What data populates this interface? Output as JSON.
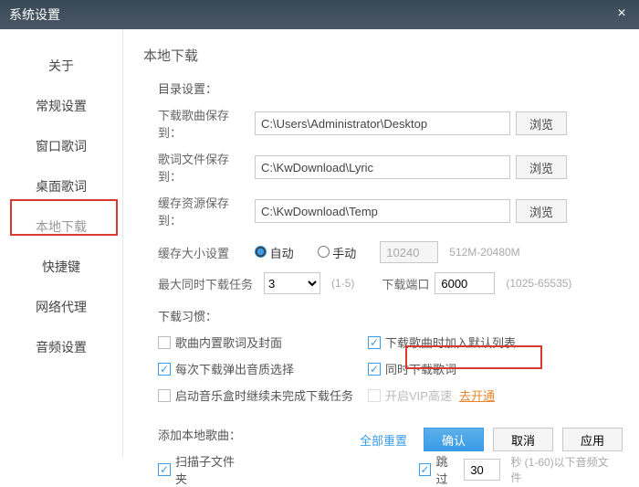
{
  "window": {
    "title": "系统设置"
  },
  "sidebar": {
    "items": [
      {
        "label": "关于"
      },
      {
        "label": "常规设置"
      },
      {
        "label": "窗口歌词"
      },
      {
        "label": "桌面歌词"
      },
      {
        "label": "本地下载"
      },
      {
        "label": "快捷键"
      },
      {
        "label": "网络代理"
      },
      {
        "label": "音频设置"
      }
    ]
  },
  "main": {
    "title": "本地下载",
    "dir": {
      "title": "目录设置：",
      "songLabel": "下载歌曲保存到：",
      "songPath": "C:\\Users\\Administrator\\Desktop",
      "lyricLabel": "歌词文件保存到：",
      "lyricPath": "C:\\KwDownload\\Lyric",
      "cacheLabel": "缓存资源保存到：",
      "cachePath": "C:\\KwDownload\\Temp",
      "browse": "浏览"
    },
    "cache": {
      "label": "缓存大小设置",
      "auto": "自动",
      "manual": "手动",
      "value": "10240",
      "hint": "512M-20480M"
    },
    "tasks": {
      "label": "最大同时下载任务",
      "value": "3",
      "hint": "(1-5)",
      "portLabel": "下载端口",
      "portValue": "6000",
      "portHint": "(1025-65535)"
    },
    "habit": {
      "title": "下载习惯：",
      "embedLyric": "歌曲内置歌词及封面",
      "addDefault": "下载歌曲时加入默认列表",
      "qualityPrompt": "每次下载弹出音质选择",
      "syncLyric": "同时下载歌词",
      "resume": "启动音乐盒时继续未完成下载任务",
      "vip": "开启VIP高速",
      "vipLink": "去开通"
    },
    "add": {
      "title": "添加本地歌曲：",
      "scan": "扫描子文件夹",
      "skip": "跳过",
      "skipValue": "30",
      "skipHint": "秒   (1-60)以下音频文件"
    },
    "footer": {
      "reset": "全部重置",
      "ok": "确认",
      "cancel": "取消",
      "apply": "应用"
    }
  }
}
